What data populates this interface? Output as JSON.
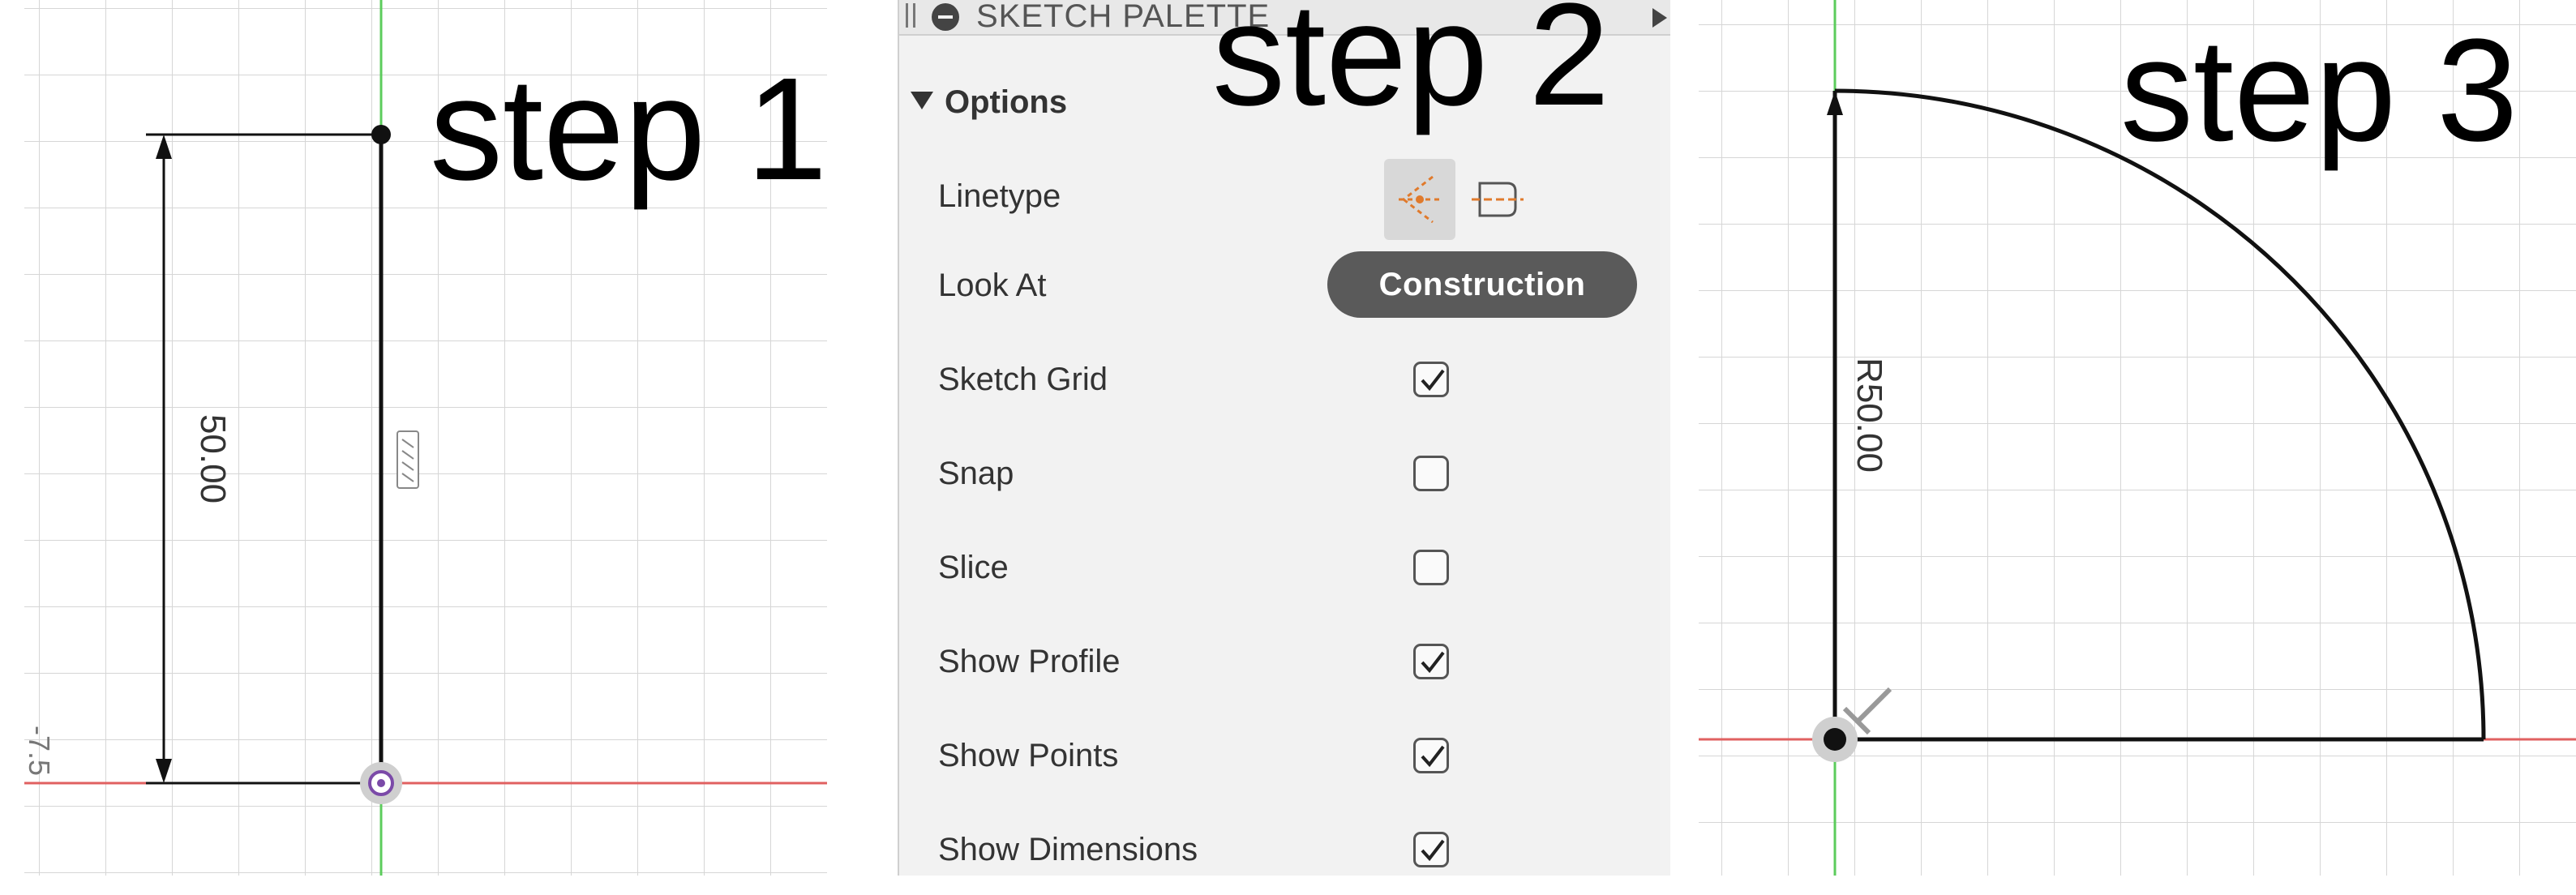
{
  "step_labels": [
    "step 1",
    "step 2",
    "step 3"
  ],
  "step1": {
    "dimension_text": "50.00",
    "side_text": "-7.5"
  },
  "palette": {
    "title": "SKETCH PALETTE",
    "options_label": "Options",
    "linetype_label": "Linetype",
    "look_at_label": "Look At",
    "construction_button": "Construction",
    "rows": [
      {
        "label": "Sketch Grid",
        "checked": true
      },
      {
        "label": "Snap",
        "checked": false
      },
      {
        "label": "Slice",
        "checked": false
      },
      {
        "label": "Show Profile",
        "checked": true
      },
      {
        "label": "Show Points",
        "checked": true
      },
      {
        "label": "Show Dimensions",
        "checked": true
      }
    ]
  },
  "step3": {
    "radius_text": "R50.00"
  },
  "colors": {
    "x_axis": "#e06060",
    "y_axis": "#5ccc5c",
    "linetype_accent": "#e07a2c",
    "button_bg": "#5a5a5a"
  }
}
